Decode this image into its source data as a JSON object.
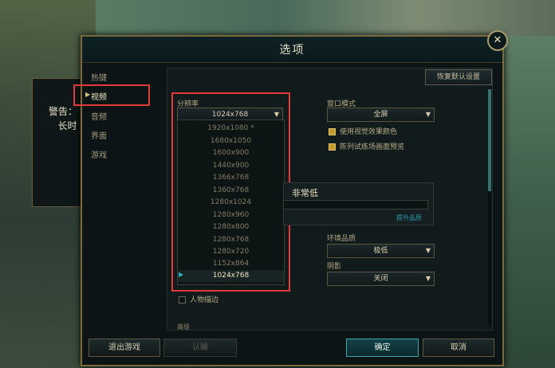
{
  "warning": {
    "line1": "警告：",
    "line2": "长时"
  },
  "dialog": {
    "title": "选项",
    "close": "✕"
  },
  "sidebar": {
    "items": [
      {
        "label": "热键"
      },
      {
        "label": "视频"
      },
      {
        "label": "音频"
      },
      {
        "label": "界面"
      },
      {
        "label": "游戏"
      }
    ]
  },
  "content": {
    "restore_defaults": "恢复默认设置",
    "resolution": {
      "label": "分辨率",
      "selected": "1024x768",
      "options": [
        "1920x1080 *",
        "1680x1050",
        "1600x900",
        "1440x900",
        "1366x768",
        "1360x768",
        "1280x1024",
        "1280x960",
        "1280x800",
        "1280x768",
        "1280x720",
        "1152x864",
        "1024x768"
      ]
    },
    "window_mode": {
      "label": "窗口模式",
      "value": "全屏"
    },
    "checkboxes": [
      {
        "label": "使用视觉效果颜色",
        "checked": true
      },
      {
        "label": "陈列试练场画面预览",
        "checked": true
      }
    ],
    "quality": {
      "level": "非常低",
      "link": "提升品质"
    },
    "environment_quality": {
      "label": "环境品质",
      "value": "极低"
    },
    "shadows": {
      "label": "阴影",
      "value": "关闭"
    },
    "character_inking": {
      "label": "人物描边",
      "checked": false
    },
    "bottom_section": "高级"
  },
  "footer": {
    "exit_game": "退出游戏",
    "surrender": "认输",
    "ok": "确定",
    "cancel": "取消"
  },
  "colors": {
    "highlight_red": "#e23a3a",
    "accent_teal": "#3ea6a8",
    "gold_border": "#7b6a3c"
  }
}
